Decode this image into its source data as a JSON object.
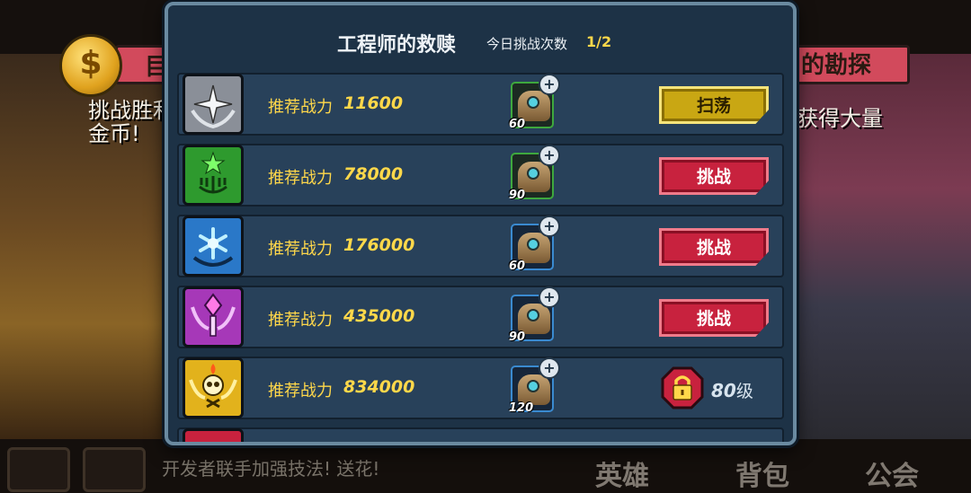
{
  "background": {
    "left_tab_label": "目",
    "left_caption": "挑战胜利获得\n金币!",
    "right_tab_label": "的勘探",
    "right_caption": "获得大量",
    "bottom_scroll_text": "开发者联手加强技法! 送花!",
    "bottom_tabs": [
      "英雄",
      "背包",
      "公会"
    ]
  },
  "panel": {
    "title": "工程师的救赎",
    "daily_challenges_label": "今日挑战次数",
    "daily_challenges_value": "1/2"
  },
  "rows": [
    {
      "badge": "silver-star-badge",
      "badge_color": "#8a8f98",
      "power_label": "推荐战力",
      "power": "11600",
      "reward_qty": "60",
      "reward_frame": "green",
      "action": {
        "type": "sweep",
        "label": "扫荡"
      }
    },
    {
      "badge": "green-menorah-badge",
      "badge_color": "#2e9a2e",
      "power_label": "推荐战力",
      "power": "78000",
      "reward_qty": "90",
      "reward_frame": "green",
      "action": {
        "type": "challenge",
        "label": "挑战"
      }
    },
    {
      "badge": "blue-snowflake-badge",
      "badge_color": "#2a78c8",
      "power_label": "推荐战力",
      "power": "176000",
      "reward_qty": "60",
      "reward_frame": "blue",
      "action": {
        "type": "challenge",
        "label": "挑战"
      }
    },
    {
      "badge": "purple-scepter-badge",
      "badge_color": "#a638b8",
      "power_label": "推荐战力",
      "power": "435000",
      "reward_qty": "90",
      "reward_frame": "blue",
      "action": {
        "type": "challenge",
        "label": "挑战"
      }
    },
    {
      "badge": "gold-skull-badge",
      "badge_color": "#e2b21c",
      "power_label": "推荐战力",
      "power": "834000",
      "reward_qty": "120",
      "reward_frame": "blue",
      "action": {
        "type": "locked",
        "level": "80",
        "level_suffix": "级"
      }
    }
  ],
  "colors": {
    "panel_bg": "#1d3246",
    "row_bg": "#28415a",
    "power_text": "#ffd84a",
    "challenge_button": "#c8223e",
    "sweep_button": "#c9a713"
  }
}
